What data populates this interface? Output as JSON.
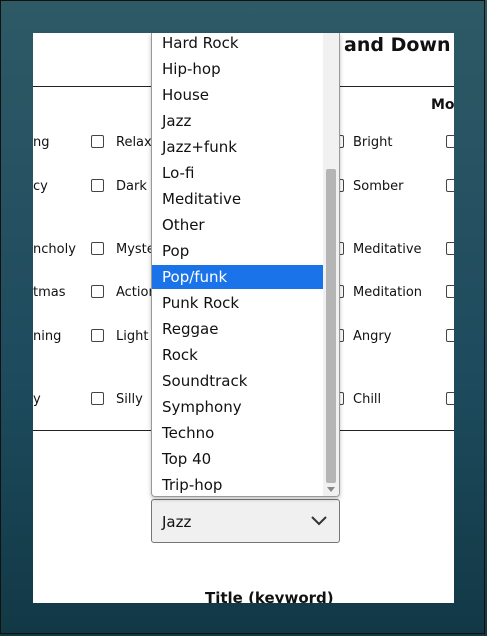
{
  "page": {
    "heading": "and Down"
  },
  "moods": {
    "column_header": "Mo",
    "col1": [
      "ng",
      "cy",
      "ncholy",
      "tmas",
      "ning",
      "y"
    ],
    "col2": [
      "Relax",
      "Dark",
      "Myste",
      "Action",
      "Light",
      "Silly"
    ],
    "col3": [
      "Bright",
      "Somber",
      "Meditative",
      "Meditation",
      "Angry",
      "Chill"
    ]
  },
  "title_keyword_label": "Title (keyword)",
  "genre_select": {
    "selected_value": "Jazz"
  },
  "genre_dropdown": {
    "options": [
      "Hard Rock",
      "Hip-hop",
      "House",
      "Jazz",
      "Jazz+funk",
      "Lo-fi",
      "Meditative",
      "Other",
      "Pop",
      "Pop/funk",
      "Punk Rock",
      "Reggae",
      "Rock",
      "Soundtrack",
      "Symphony",
      "Techno",
      "Top 40",
      "Trip-hop"
    ],
    "highlighted": "Pop/funk"
  }
}
